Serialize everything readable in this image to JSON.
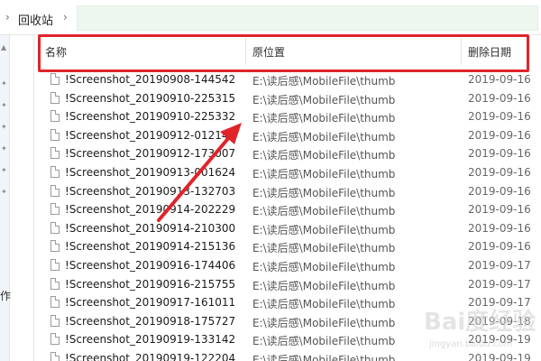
{
  "breadcrumb": {
    "location": "回收站"
  },
  "nav": {
    "side_label": "作"
  },
  "columns": {
    "name": "名称",
    "original_location": "原位置",
    "date_deleted": "删除日期"
  },
  "rows": [
    {
      "name": "!Screenshot_20190908-144542.j...",
      "location": "E:\\读后感\\MobileFile\\thumb",
      "date": "2019-09-16"
    },
    {
      "name": "!Screenshot_20190910-225315.j...",
      "location": "E:\\读后感\\MobileFile\\thumb",
      "date": "2019-09-16"
    },
    {
      "name": "!Screenshot_20190910-225332.j...",
      "location": "E:\\读后感\\MobileFile\\thumb",
      "date": "2019-09-16"
    },
    {
      "name": "!Screenshot_20190912-012146.j...",
      "location": "E:\\读后感\\MobileFile\\thumb",
      "date": "2019-09-16"
    },
    {
      "name": "!Screenshot_20190912-173007.j...",
      "location": "E:\\读后感\\MobileFile\\thumb",
      "date": "2019-09-16"
    },
    {
      "name": "!Screenshot_20190913-001624.j...",
      "location": "E:\\读后感\\MobileFile\\thumb",
      "date": "2019-09-16"
    },
    {
      "name": "!Screenshot_20190913-132703.j...",
      "location": "E:\\读后感\\MobileFile\\thumb",
      "date": "2019-09-16"
    },
    {
      "name": "!Screenshot_20190914-202229.j...",
      "location": "E:\\读后感\\MobileFile\\thumb",
      "date": "2019-09-16"
    },
    {
      "name": "!Screenshot_20190914-210300.j...",
      "location": "E:\\读后感\\MobileFile\\thumb",
      "date": "2019-09-16"
    },
    {
      "name": "!Screenshot_20190914-215136.j...",
      "location": "E:\\读后感\\MobileFile\\thumb",
      "date": "2019-09-16"
    },
    {
      "name": "!Screenshot_20190916-174406.j...",
      "location": "E:\\读后感\\MobileFile\\thumb",
      "date": "2019-09-17"
    },
    {
      "name": "!Screenshot_20190916-215755.j...",
      "location": "E:\\读后感\\MobileFile\\thumb",
      "date": "2019-09-17"
    },
    {
      "name": "!Screenshot_20190917-161011.j...",
      "location": "E:\\读后感\\MobileFile\\thumb",
      "date": "2019-09-17"
    },
    {
      "name": "!Screenshot_20190918-175727.j...",
      "location": "E:\\读后感\\MobileFile\\thumb",
      "date": "2019-09-18"
    },
    {
      "name": "!Screenshot_20190919-133142.j...",
      "location": "E:\\读后感\\MobileFile\\thumb",
      "date": "2019-09-19"
    },
    {
      "name": "!Screenshot_20190919-122204.j...",
      "location": "E:\\读后感\\MobileFile\\thumb",
      "date": "2019-09-19"
    }
  ],
  "annotation": {
    "highlight_color": "#e0242a"
  },
  "watermark": {
    "text": "Bai度经验",
    "url": "jingyan.baidu.com"
  }
}
